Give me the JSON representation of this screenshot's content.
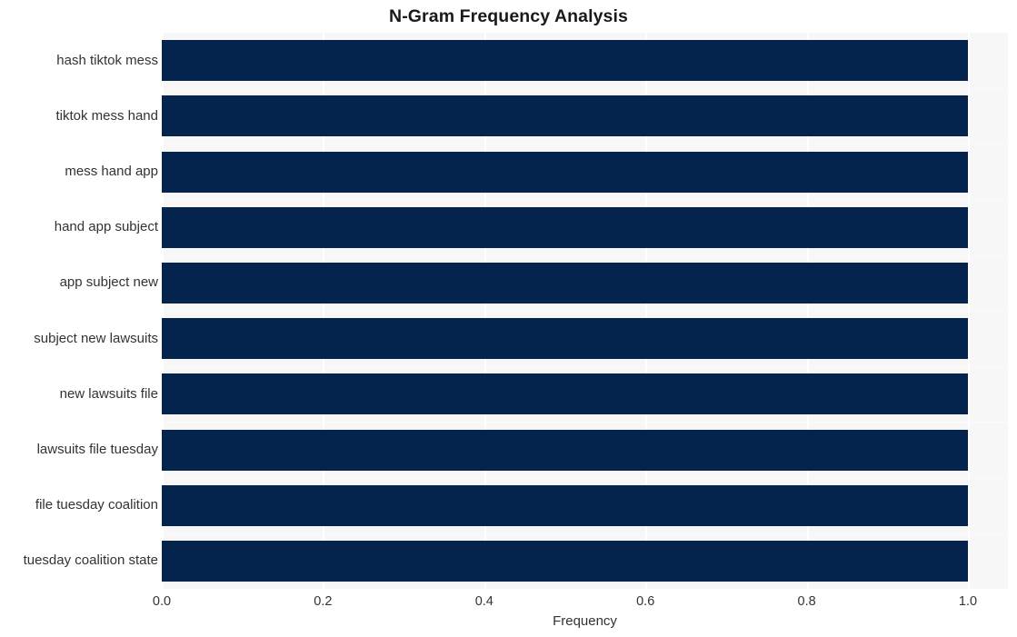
{
  "chart_data": {
    "type": "bar",
    "orientation": "horizontal",
    "title": "N-Gram Frequency Analysis",
    "xlabel": "Frequency",
    "ylabel": "",
    "categories": [
      "hash tiktok mess",
      "tiktok mess hand",
      "mess hand app",
      "hand app subject",
      "app subject new",
      "subject new lawsuits",
      "new lawsuits file",
      "lawsuits file tuesday",
      "file tuesday coalition",
      "tuesday coalition state"
    ],
    "values": [
      1.0,
      1.0,
      1.0,
      1.0,
      1.0,
      1.0,
      1.0,
      1.0,
      1.0,
      1.0
    ],
    "xlim": [
      0.0,
      1.0
    ],
    "xticks": [
      0.0,
      0.2,
      0.4,
      0.6,
      0.8,
      1.0
    ],
    "xtick_labels": [
      "0.0",
      "0.2",
      "0.4",
      "0.6",
      "0.8",
      "1.0"
    ],
    "grid": true,
    "legend": false,
    "bar_color": "#04234d",
    "plot_background": "#f7f7f7",
    "figure_background": "#ffffff",
    "gridline_color": "#ffffff"
  }
}
